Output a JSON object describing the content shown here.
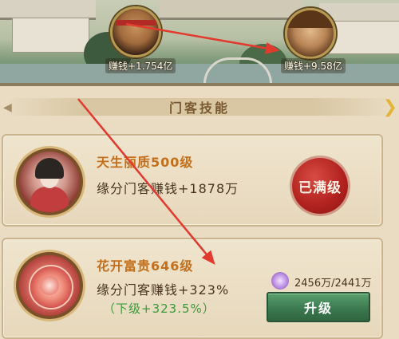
{
  "scene": {
    "left_hero": {
      "earn_label": "赚钱+1.754亿"
    },
    "right_hero": {
      "earn_label": "赚钱+9.58亿"
    }
  },
  "section": {
    "title": "门客技能"
  },
  "skills": [
    {
      "name": "天生丽质500级",
      "effect": "缘分门客赚钱+1878万",
      "status_label": "已满级"
    },
    {
      "name": "花开富贵646级",
      "effect": "缘分门客赚钱+323%",
      "next_level": "（下级+323.5%）",
      "cost": "2456万/2441万",
      "upgrade_label": "升级"
    }
  ],
  "colors": {
    "annotation_arrow": "#e23a2e",
    "skill_name": "#c46f1c",
    "next_level_text": "#3b9a3a",
    "upgrade_button": "#3c7a50",
    "maxed_seal": "#b3231f"
  }
}
